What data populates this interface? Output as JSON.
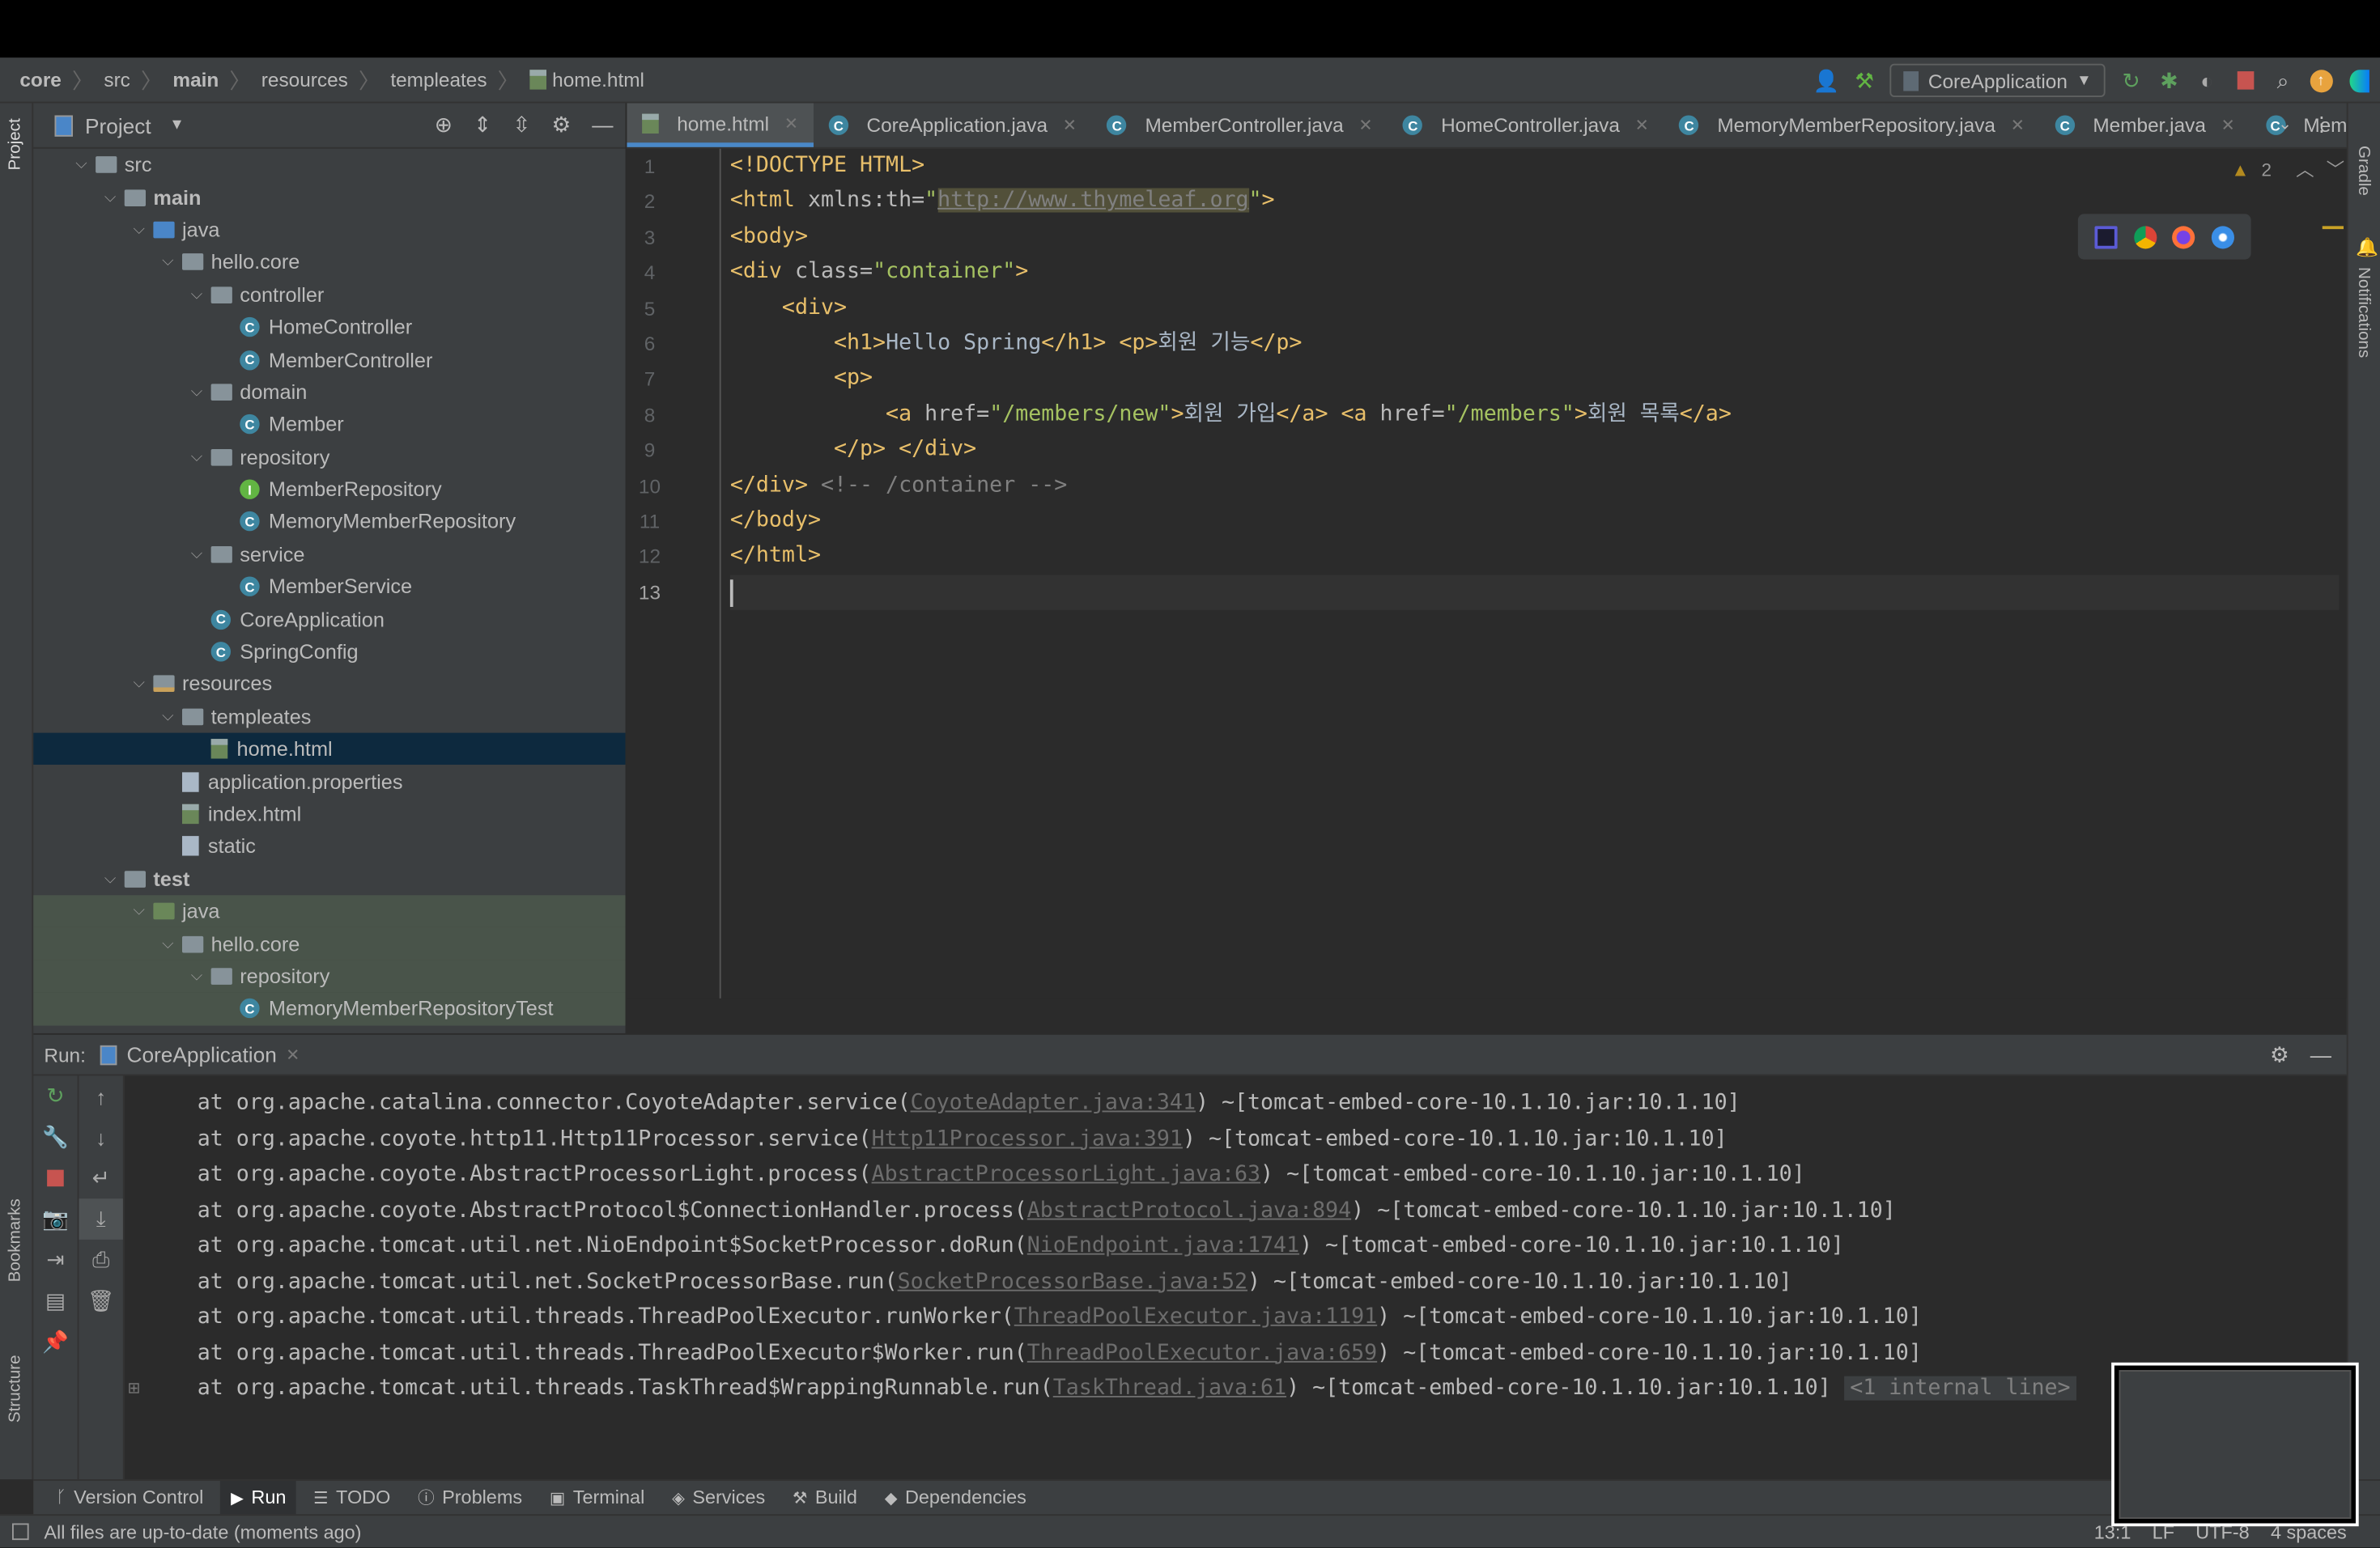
{
  "breadcrumb": [
    "core",
    "src",
    "main",
    "resources",
    "templeates",
    "home.html"
  ],
  "toolbar": {
    "run_config": "CoreApplication",
    "icons": [
      "account-icon",
      "build-hammer-icon",
      "rerun-icon",
      "debug-icon",
      "coverage-icon",
      "stop-icon",
      "search-icon",
      "update-icon",
      "ide-logo-icon"
    ]
  },
  "left_strip": {
    "project": "Project",
    "bookmarks": "Bookmarks",
    "structure": "Structure"
  },
  "right_strip": {
    "gradle": "Gradle",
    "notifications": "Notifications"
  },
  "project": {
    "title": "Project",
    "tree": [
      {
        "label": "src",
        "depth": 0,
        "type": "folder",
        "open": true
      },
      {
        "label": "main",
        "depth": 1,
        "type": "folder",
        "open": true,
        "bold": true
      },
      {
        "label": "java",
        "depth": 2,
        "type": "folder-src",
        "open": true
      },
      {
        "label": "hello.core",
        "depth": 3,
        "type": "folder",
        "open": true
      },
      {
        "label": "controller",
        "depth": 4,
        "type": "folder",
        "open": true
      },
      {
        "label": "HomeController",
        "depth": 5,
        "type": "class"
      },
      {
        "label": "MemberController",
        "depth": 5,
        "type": "class"
      },
      {
        "label": "domain",
        "depth": 4,
        "type": "folder",
        "open": true
      },
      {
        "label": "Member",
        "depth": 5,
        "type": "class"
      },
      {
        "label": "repository",
        "depth": 4,
        "type": "folder",
        "open": true
      },
      {
        "label": "MemberRepository",
        "depth": 5,
        "type": "interface"
      },
      {
        "label": "MemoryMemberRepository",
        "depth": 5,
        "type": "class"
      },
      {
        "label": "service",
        "depth": 4,
        "type": "folder",
        "open": true
      },
      {
        "label": "MemberService",
        "depth": 5,
        "type": "class"
      },
      {
        "label": "CoreApplication",
        "depth": 4,
        "type": "class"
      },
      {
        "label": "SpringConfig",
        "depth": 4,
        "type": "class"
      },
      {
        "label": "resources",
        "depth": 2,
        "type": "folder-res",
        "open": true
      },
      {
        "label": "templeates",
        "depth": 3,
        "type": "folder",
        "open": true
      },
      {
        "label": "home.html",
        "depth": 4,
        "type": "html",
        "selected": true
      },
      {
        "label": "application.properties",
        "depth": 3,
        "type": "file"
      },
      {
        "label": "index.html",
        "depth": 3,
        "type": "html"
      },
      {
        "label": "static",
        "depth": 3,
        "type": "file"
      },
      {
        "label": "test",
        "depth": 1,
        "type": "folder",
        "open": true,
        "bold": true
      },
      {
        "label": "java",
        "depth": 2,
        "type": "folder-test",
        "open": true,
        "test": true
      },
      {
        "label": "hello.core",
        "depth": 3,
        "type": "folder",
        "open": true,
        "test": true
      },
      {
        "label": "repository",
        "depth": 4,
        "type": "folder",
        "open": true,
        "test": true
      },
      {
        "label": "MemoryMemberRepositoryTest",
        "depth": 5,
        "type": "class",
        "test": true
      }
    ]
  },
  "tabs": [
    {
      "label": "home.html",
      "icon": "html-file-icon",
      "active": true
    },
    {
      "label": "CoreApplication.java",
      "icon": "class-icon"
    },
    {
      "label": "MemberController.java",
      "icon": "class-icon"
    },
    {
      "label": "HomeController.java",
      "icon": "class-icon"
    },
    {
      "label": "MemoryMemberRepository.java",
      "icon": "class-icon"
    },
    {
      "label": "Member.java",
      "icon": "class-icon"
    },
    {
      "label": "MemberSe",
      "icon": "class-icon"
    }
  ],
  "editor": {
    "warnings": "2",
    "current_line": 13,
    "lines": [
      [
        [
          "<!DOCTYPE HTML>",
          "tag"
        ]
      ],
      [
        [
          "<html ",
          "tag"
        ],
        [
          "xmlns:th=",
          "attr"
        ],
        [
          "\"",
          "val"
        ],
        [
          "http://www.thymeleaf.org",
          "url"
        ],
        [
          "\"",
          "val"
        ],
        [
          ">",
          "tag"
        ]
      ],
      [
        [
          "<body>",
          "tag"
        ]
      ],
      [
        [
          "<div ",
          "tag"
        ],
        [
          "class=",
          "attr"
        ],
        [
          "\"container\"",
          "val"
        ],
        [
          ">",
          "tag"
        ]
      ],
      [
        [
          "    <div>",
          "tag"
        ]
      ],
      [
        [
          "        <h1>",
          "tag"
        ],
        [
          "Hello Spring",
          "txt"
        ],
        [
          "</h1>",
          "tag"
        ],
        [
          " ",
          "txt"
        ],
        [
          "<p>",
          "tag"
        ],
        [
          "회원 기능",
          "txt"
        ],
        [
          "</p>",
          "tag"
        ]
      ],
      [
        [
          "        <p>",
          "tag"
        ]
      ],
      [
        [
          "            <a ",
          "tag"
        ],
        [
          "href=",
          "attr"
        ],
        [
          "\"/members/new\"",
          "val"
        ],
        [
          ">",
          "tag"
        ],
        [
          "회원 가입",
          "txt"
        ],
        [
          "</a>",
          "tag"
        ],
        [
          " ",
          "txt"
        ],
        [
          "<a ",
          "tag"
        ],
        [
          "href=",
          "attr"
        ],
        [
          "\"/members\"",
          "val"
        ],
        [
          ">",
          "tag"
        ],
        [
          "회원 목록",
          "txt"
        ],
        [
          "</a>",
          "tag"
        ]
      ],
      [
        [
          "        </p>",
          "tag"
        ],
        [
          " ",
          "txt"
        ],
        [
          "</div>",
          "tag"
        ]
      ],
      [
        [
          "</div>",
          "tag"
        ],
        [
          " <!-- /container -->",
          "cm"
        ]
      ],
      [
        [
          "</body>",
          "tag"
        ]
      ],
      [
        [
          "</html>",
          "tag"
        ]
      ],
      []
    ]
  },
  "run": {
    "label": "Run:",
    "tab": "CoreApplication",
    "console": [
      {
        "pre": "at org.apache.catalina.connector.CoyoteAdapter.service(",
        "link": "CoyoteAdapter.java:341",
        "post": ") ~[tomcat-embed-core-10.1.10.jar:10.1.10]"
      },
      {
        "pre": "at org.apache.coyote.http11.Http11Processor.service(",
        "link": "Http11Processor.java:391",
        "post": ") ~[tomcat-embed-core-10.1.10.jar:10.1.10]"
      },
      {
        "pre": "at org.apache.coyote.AbstractProcessorLight.process(",
        "link": "AbstractProcessorLight.java:63",
        "post": ") ~[tomcat-embed-core-10.1.10.jar:10.1.10]"
      },
      {
        "pre": "at org.apache.coyote.AbstractProtocol$ConnectionHandler.process(",
        "link": "AbstractProtocol.java:894",
        "post": ") ~[tomcat-embed-core-10.1.10.jar:10.1.10]"
      },
      {
        "pre": "at org.apache.tomcat.util.net.NioEndpoint$SocketProcessor.doRun(",
        "link": "NioEndpoint.java:1741",
        "post": ") ~[tomcat-embed-core-10.1.10.jar:10.1.10]"
      },
      {
        "pre": "at org.apache.tomcat.util.net.SocketProcessorBase.run(",
        "link": "SocketProcessorBase.java:52",
        "post": ") ~[tomcat-embed-core-10.1.10.jar:10.1.10]"
      },
      {
        "pre": "at org.apache.tomcat.util.threads.ThreadPoolExecutor.runWorker(",
        "link": "ThreadPoolExecutor.java:1191",
        "post": ") ~[tomcat-embed-core-10.1.10.jar:10.1.10]"
      },
      {
        "pre": "at org.apache.tomcat.util.threads.ThreadPoolExecutor$Worker.run(",
        "link": "ThreadPoolExecutor.java:659",
        "post": ") ~[tomcat-embed-core-10.1.10.jar:10.1.10]"
      },
      {
        "pre": "at org.apache.tomcat.util.threads.TaskThread$WrappingRunnable.run(",
        "link": "TaskThread.java:61",
        "post": ") ~[tomcat-embed-core-10.1.10.jar:10.1.10]",
        "badge": "<1 internal line>"
      }
    ]
  },
  "bottom_tools": [
    {
      "label": "Version Control",
      "icon": "vcs-icon"
    },
    {
      "label": "Run",
      "icon": "run-icon",
      "active": true
    },
    {
      "label": "TODO",
      "icon": "list-icon"
    },
    {
      "label": "Problems",
      "icon": "problems-icon"
    },
    {
      "label": "Terminal",
      "icon": "terminal-icon"
    },
    {
      "label": "Services",
      "icon": "services-icon"
    },
    {
      "label": "Build",
      "icon": "hammer-icon"
    },
    {
      "label": "Dependencies",
      "icon": "dependencies-icon"
    }
  ],
  "status": {
    "message": "All files are up-to-date (moments ago)",
    "position": "13:1",
    "line_ending": "LF",
    "encoding": "UTF-8",
    "indent": "4 spaces"
  },
  "colors": {
    "tag": "#e8bf6a",
    "attr": "#bababa",
    "value": "#a5c261",
    "selection": "#0d293e",
    "accent": "#4a88c7"
  }
}
